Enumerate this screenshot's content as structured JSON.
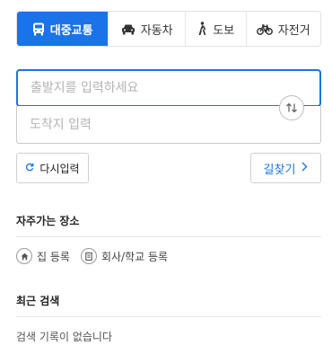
{
  "tabs": [
    {
      "label": "대중교통",
      "icon": "bus-icon",
      "active": true
    },
    {
      "label": "자동차",
      "icon": "car-icon",
      "active": false
    },
    {
      "label": "도보",
      "icon": "walk-icon",
      "active": false
    },
    {
      "label": "자전거",
      "icon": "bicycle-icon",
      "active": false
    }
  ],
  "route": {
    "origin_placeholder": "출발지를 입력하세요",
    "destination_placeholder": "도착지 입력",
    "swap_icon": "swap-arrows-icon"
  },
  "actions": {
    "reset_label": "다시입력",
    "reset_icon": "refresh-icon",
    "find_label": "길찾기",
    "find_icon": "chevron-right-icon"
  },
  "favorites": {
    "title": "자주가는 장소",
    "items": [
      {
        "label": "집 등록",
        "icon": "home-icon"
      },
      {
        "label": "회사/학교 등록",
        "icon": "building-icon"
      }
    ]
  },
  "recent": {
    "title": "최근 검색",
    "empty_text": "검색 기록이 없습니다"
  },
  "colors": {
    "accent": "#1a73e8",
    "border": "#c9c9c9",
    "placeholder": "#b3b3b3"
  }
}
